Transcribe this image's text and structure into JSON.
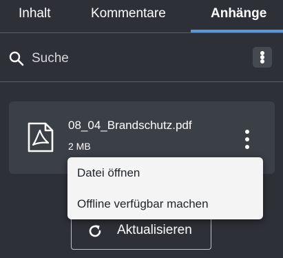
{
  "tabs": [
    {
      "label": "Inhalt"
    },
    {
      "label": "Kommentare"
    },
    {
      "label": "Anhänge"
    }
  ],
  "active_tab": "Anhänge",
  "search": {
    "placeholder": "Suche"
  },
  "file": {
    "name": "08_04_Brandschutz.pdf",
    "size": "2 MB",
    "icon": "pdf-file-icon"
  },
  "context_menu": {
    "items": [
      {
        "label": "Datei öffnen"
      },
      {
        "label": "Offline verfügbar machen"
      }
    ]
  },
  "refresh": {
    "label": "Aktualisieren",
    "icon": "refresh-icon"
  },
  "colors": {
    "background": "#2d3036",
    "card": "#3b3f46",
    "accent": "#5b97d6",
    "menu_background": "#f4f4f5"
  }
}
